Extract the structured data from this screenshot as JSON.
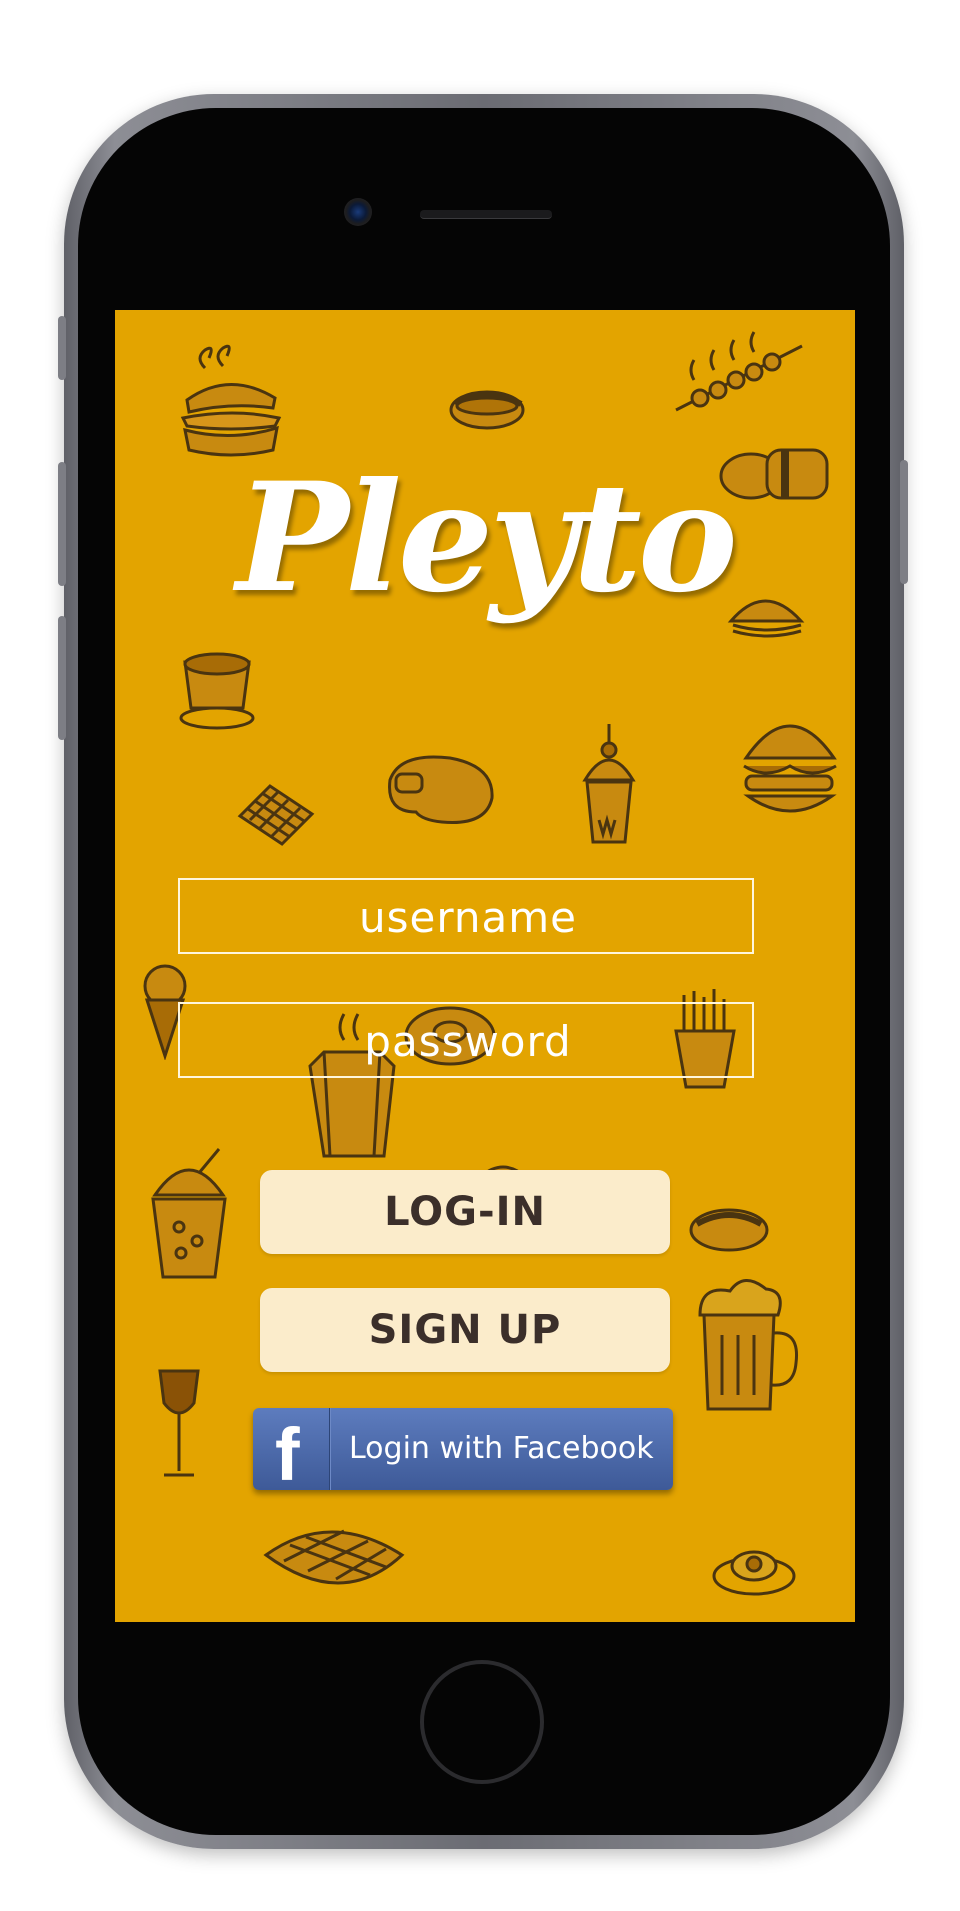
{
  "app": {
    "name": "Pleyto"
  },
  "login_form": {
    "username_placeholder": "username",
    "password_placeholder": "password",
    "login_label": "LOG-IN",
    "signup_label": "SIGN UP",
    "facebook_label": "Login with Facebook",
    "facebook_icon_glyph": "f"
  },
  "colors": {
    "background": "#e3a400",
    "button_fill": "#fbeccb",
    "button_text": "#3b2f2a",
    "facebook_blue": "#4a67a8",
    "logo_text": "#ffffff"
  },
  "background_doodles": [
    "sandwich-icon",
    "hotdog-icon",
    "skewer-icon",
    "sushi-icon",
    "burger-icon",
    "taco-icon",
    "cupcake-icon",
    "steak-icon",
    "waffle-icon",
    "sundae-icon",
    "ice-cream-cone-icon",
    "donut-icon",
    "fries-icon",
    "coffee-cup-icon",
    "smoothie-icon",
    "bun-icon",
    "beer-mug-icon",
    "wine-glass-icon",
    "waffle-plate-icon",
    "egg-plate-icon"
  ]
}
